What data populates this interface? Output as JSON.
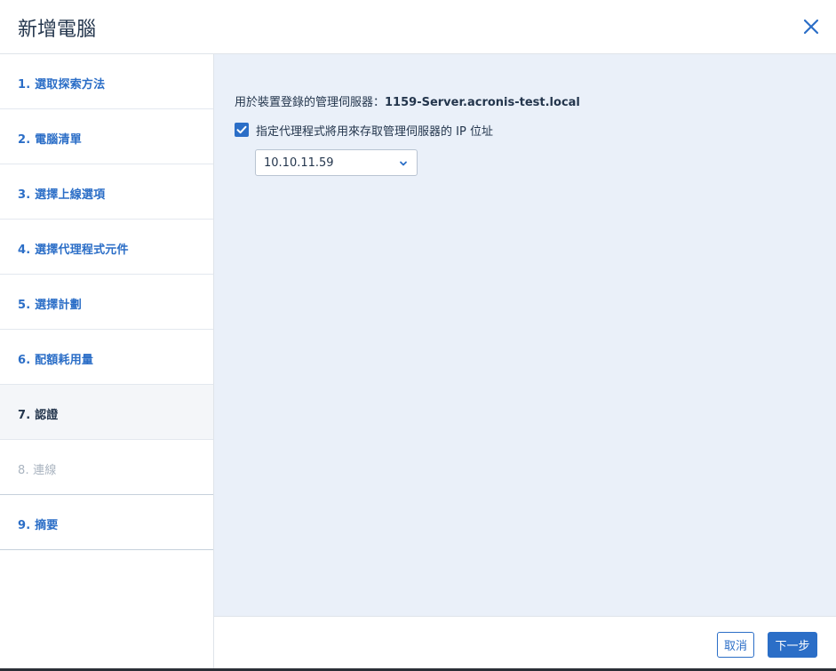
{
  "dialog": {
    "title": "新增電腦",
    "close_icon": "close-icon"
  },
  "sidebar": {
    "steps": [
      {
        "label": "1. 選取探索方法",
        "state": "link"
      },
      {
        "label": "2. 電腦清單",
        "state": "link"
      },
      {
        "label": "3. 選擇上線選項",
        "state": "link"
      },
      {
        "label": "4. 選擇代理程式元件",
        "state": "link"
      },
      {
        "label": "5. 選擇計劃",
        "state": "link"
      },
      {
        "label": "6. 配額耗用量",
        "state": "link"
      },
      {
        "label": "7. 認證",
        "state": "active"
      },
      {
        "label": "8. 連線",
        "state": "disabled"
      },
      {
        "label": "9. 摘要",
        "state": "link"
      }
    ]
  },
  "main": {
    "server_label": "用於裝置登錄的管理伺服器：",
    "server_value": "1159-Server.acronis-test.local",
    "checkbox_label": "指定代理程式將用來存取管理伺服器的 IP 位址",
    "checkbox_checked": true,
    "ip_select_value": "10.10.11.59"
  },
  "footer": {
    "cancel_label": "取消",
    "next_label": "下一步"
  },
  "colors": {
    "accent": "#2b6ec7",
    "content_bg": "#eaf0f9",
    "text": "#24364d",
    "disabled": "#aab4c0"
  }
}
